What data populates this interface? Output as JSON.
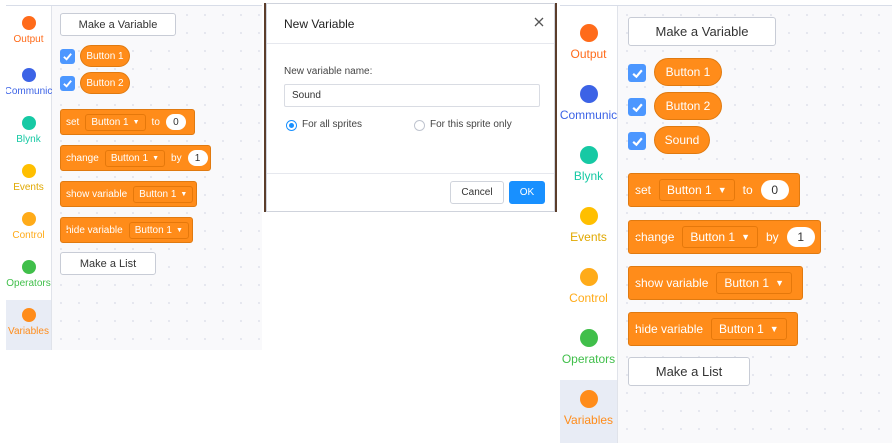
{
  "colors": {
    "accent": "#4c97ff",
    "variables_orange": "#ff8c1a",
    "primary_button": "#1890ff"
  },
  "categories": [
    {
      "label": "Output",
      "color": "#ff6b1a",
      "icon": "dot"
    },
    {
      "label": "Communic",
      "color": "#3c63e6",
      "icon": "dot"
    },
    {
      "label": "Blynk",
      "color": "#16c9a4",
      "icon": "dot"
    },
    {
      "label": "Events",
      "color": "#ffbf00",
      "icon": "dot"
    },
    {
      "label": "Control",
      "color": "#ffab19",
      "icon": "dot"
    },
    {
      "label": "Operators",
      "color": "#40bf4a",
      "icon": "dot"
    },
    {
      "label": "Variables",
      "color": "#ff8c1a",
      "icon": "dot"
    }
  ],
  "palette_before": {
    "make_variable": "Make a Variable",
    "variables": [
      "Button 1",
      "Button 2"
    ],
    "blocks": {
      "set": {
        "label": "set",
        "var": "Button 1",
        "to": "to",
        "value": "0"
      },
      "change": {
        "label": "change",
        "var": "Button 1",
        "by": "by",
        "value": "1"
      },
      "show": {
        "label": "show variable",
        "var": "Button 1"
      },
      "hide": {
        "label": "hide variable",
        "var": "Button 1"
      }
    },
    "make_list": "Make a List"
  },
  "dialog": {
    "title": "New Variable",
    "close_icon": "close-icon",
    "name_label": "New variable name:",
    "name_value": "Sound",
    "scope_options": [
      "For all sprites",
      "For this sprite only"
    ],
    "selected_scope": "For all sprites",
    "cancel": "Cancel",
    "ok": "OK"
  },
  "palette_after": {
    "make_variable": "Make a Variable",
    "variables": [
      "Button 1",
      "Button 2",
      "Sound"
    ],
    "blocks": {
      "set": {
        "label": "set",
        "var": "Button 1",
        "to": "to",
        "value": "0"
      },
      "change": {
        "label": "change",
        "var": "Button 1",
        "by": "by",
        "value": "1"
      },
      "show": {
        "label": "show variable",
        "var": "Button 1"
      },
      "hide": {
        "label": "hide variable",
        "var": "Button 1"
      }
    },
    "make_list": "Make a List"
  }
}
